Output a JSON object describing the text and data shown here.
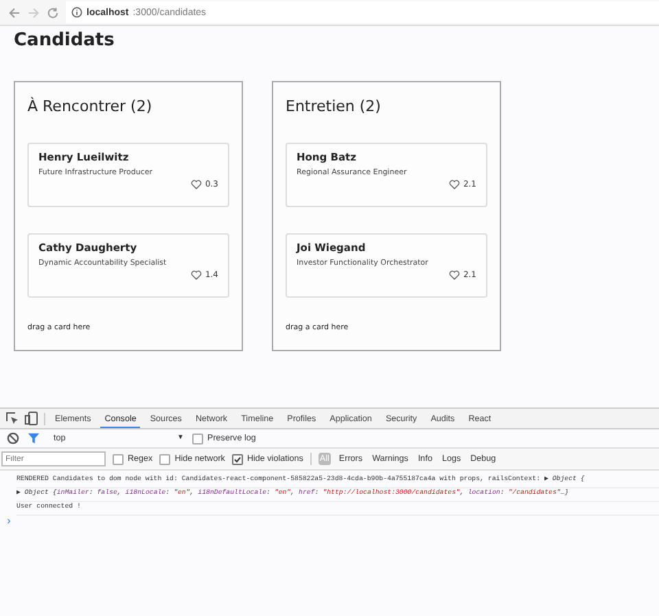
{
  "browser": {
    "url_host": "localhost",
    "url_path": ":3000/candidates"
  },
  "page": {
    "title": "Candidats",
    "columns": [
      {
        "title": "À Rencontrer (2)",
        "drop_hint": "drag a card here",
        "cards": [
          {
            "name": "Henry Lueilwitz",
            "role": "Future Infrastructure Producer",
            "score": "0.3"
          },
          {
            "name": "Cathy Daugherty",
            "role": "Dynamic Accountability Specialist",
            "score": "1.4"
          }
        ]
      },
      {
        "title": "Entretien (2)",
        "drop_hint": "drag a card here",
        "cards": [
          {
            "name": "Hong Batz",
            "role": "Regional Assurance Engineer",
            "score": "2.1"
          },
          {
            "name": "Joi Wiegand",
            "role": "Investor Functionality Orchestrator",
            "score": "2.1"
          }
        ]
      }
    ]
  },
  "devtools": {
    "tabs": [
      {
        "label": "Elements",
        "selected": false
      },
      {
        "label": "Console",
        "selected": true
      },
      {
        "label": "Sources",
        "selected": false
      },
      {
        "label": "Network",
        "selected": false
      },
      {
        "label": "Timeline",
        "selected": false
      },
      {
        "label": "Profiles",
        "selected": false
      },
      {
        "label": "Application",
        "selected": false
      },
      {
        "label": "Security",
        "selected": false
      },
      {
        "label": "Audits",
        "selected": false
      },
      {
        "label": "React",
        "selected": false
      }
    ],
    "context": "top",
    "context_caret": "▼",
    "preserve_log": {
      "label": "Preserve log",
      "checked": false
    },
    "filter": {
      "placeholder": "Filter"
    },
    "options": [
      {
        "label": "Regex",
        "checked": false
      },
      {
        "label": "Hide network",
        "checked": false
      },
      {
        "label": "Hide violations",
        "checked": true
      }
    ],
    "levels": [
      {
        "label": "All",
        "selected": true
      },
      {
        "label": "Errors",
        "selected": false
      },
      {
        "label": "Warnings",
        "selected": false
      },
      {
        "label": "Info",
        "selected": false
      },
      {
        "label": "Logs",
        "selected": false
      },
      {
        "label": "Debug",
        "selected": false
      }
    ],
    "log": [
      {
        "kind": "text",
        "text": "RENDERED Candidates to dom node with id: Candidates-react-component-585822a5-23d8-4cda-b90b-4a755187ca4a with props, railsContext: ",
        "object": "▶ Object {"
      },
      {
        "kind": "object",
        "segments": [
          {
            "text": "▶ Object {",
            "kind": "plain"
          },
          {
            "text": "inMailer",
            "kind": "key"
          },
          {
            "text": ": ",
            "kind": "plain"
          },
          {
            "text": "false",
            "kind": "bool"
          },
          {
            "text": ", ",
            "kind": "plain"
          },
          {
            "text": "i18nLocale",
            "kind": "key"
          },
          {
            "text": ": ",
            "kind": "plain"
          },
          {
            "text": "\"en\"",
            "kind": "string"
          },
          {
            "text": ", ",
            "kind": "plain"
          },
          {
            "text": "i18nDefaultLocale",
            "kind": "key"
          },
          {
            "text": ": ",
            "kind": "plain"
          },
          {
            "text": "\"en\"",
            "kind": "string"
          },
          {
            "text": ", ",
            "kind": "plain"
          },
          {
            "text": "href",
            "kind": "key"
          },
          {
            "text": ": ",
            "kind": "plain"
          },
          {
            "text": "\"http://localhost:3000/candidates\"",
            "kind": "string"
          },
          {
            "text": ", ",
            "kind": "plain"
          },
          {
            "text": "location",
            "kind": "key"
          },
          {
            "text": ": ",
            "kind": "plain"
          },
          {
            "text": "\"/candidates\"",
            "kind": "string"
          },
          {
            "text": "…}",
            "kind": "plain"
          }
        ]
      },
      {
        "kind": "text",
        "text": "User connected !"
      }
    ],
    "prompt": "›"
  }
}
